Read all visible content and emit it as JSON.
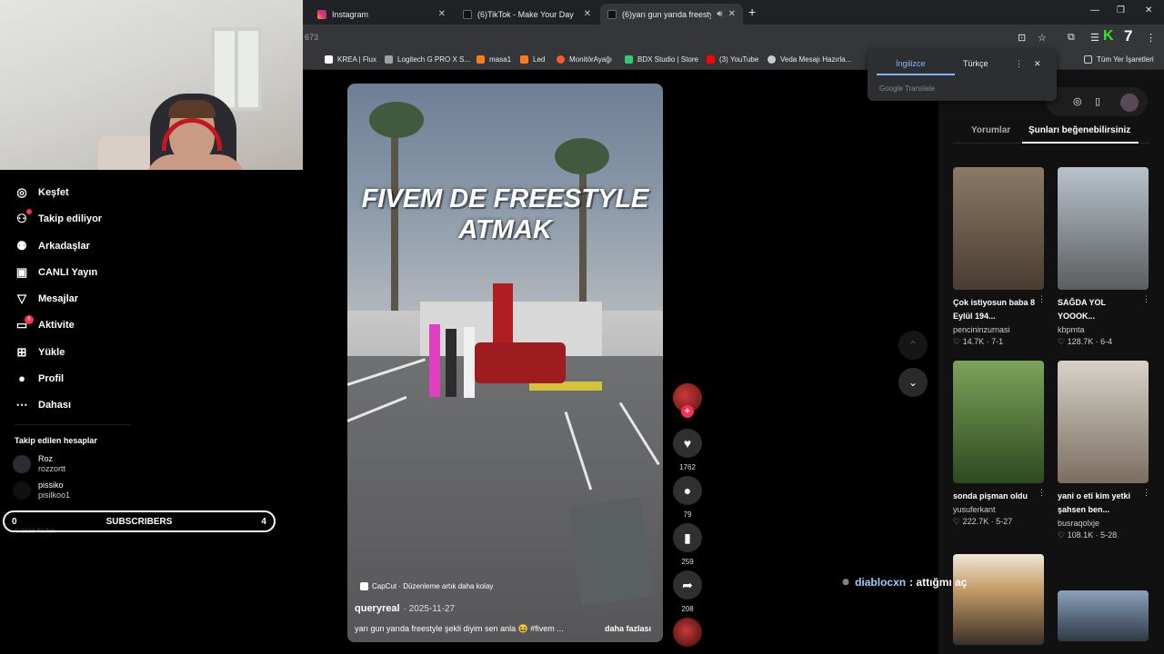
{
  "browser": {
    "tabs": [
      {
        "title": "Instagram",
        "color": "#e1306c"
      },
      {
        "title": "(6)TikTok - Make Your Day",
        "color": "#111111"
      },
      {
        "title": "(6)yarı gun yarıda freestyle",
        "color": "#111111"
      }
    ],
    "url": "673",
    "extension_badge": "7",
    "bookmarks": [
      {
        "label": "KREA | Flux",
        "color": "#ffffff"
      },
      {
        "label": "Logitech G PRO X S...",
        "color": "#9aa0a6"
      },
      {
        "label": "masa1",
        "color": "#ff7b1a"
      },
      {
        "label": "Led",
        "color": "#ff7b1a"
      },
      {
        "label": "MonitörAyağı",
        "color": "#ff5a1f"
      },
      {
        "label": "BDX Studio | Store",
        "color": "#2ecc71"
      },
      {
        "label": "(3) YouTube",
        "color": "#ff0000"
      },
      {
        "label": "Veda Mesajı Hazırla...",
        "color": "#cccccc"
      }
    ],
    "all_bookmarks": "Tüm Yer İşaretleri"
  },
  "translate": {
    "lang_from": "İngilizce",
    "lang_to": "Türkçe",
    "footer": "Google Translate"
  },
  "sidebar": {
    "items": [
      {
        "label": "Keşfet",
        "icon": "compass-icon"
      },
      {
        "label": "Takip ediliyor",
        "icon": "user-follow-icon"
      },
      {
        "label": "Arkadaşlar",
        "icon": "friends-icon"
      },
      {
        "label": "CANLI Yayın",
        "icon": "live-icon"
      },
      {
        "label": "Mesajlar",
        "icon": "message-icon"
      },
      {
        "label": "Aktivite",
        "icon": "activity-icon"
      },
      {
        "label": "Yükle",
        "icon": "upload-icon"
      },
      {
        "label": "Profil",
        "icon": "profile-icon"
      },
      {
        "label": "Dahası",
        "icon": "more-icon"
      }
    ],
    "activity_badge": "6",
    "followed_title": "Takip edilen hesaplar",
    "followed": [
      {
        "name": "Roz",
        "handle": "rozzortt"
      },
      {
        "name": "pissiko",
        "handle": "pisilkoo1"
      }
    ],
    "copyright": "© 2026 TikTok"
  },
  "subscribers_bar": {
    "left": "0",
    "label": "SUBSCRIBERS",
    "right": "4"
  },
  "video": {
    "title_line1": "FIVEM DE FREESTYLE",
    "title_line2": "ATMAK",
    "capcut": "CapCut · Düzenleme artık daha kolay",
    "author": "queryreal",
    "date": "· 2025-11-27",
    "description": "yarı gun yarıda freestyle şekli diyim sen anla 😆 #fivem ...",
    "more": "daha fazlası"
  },
  "actions": {
    "likes": "1762",
    "comments": "79",
    "saves": "259",
    "shares": "208"
  },
  "right_panel": {
    "tab_comments": "Yorumlar",
    "tab_suggested": "Şunları beğenebilirsiniz",
    "cards": [
      {
        "title": "Çok istiyosun baba 8 Eylül 194...",
        "user": "pencininzurnasi",
        "stats": "♡ 14.7K · 7-1",
        "color1": "#6b5a4a",
        "color2": "#3e342c"
      },
      {
        "title": "SAĞDA YOL YOOOK...",
        "user": "kbpmta",
        "stats": "♡ 128.7K · 6-4",
        "color1": "#9aa6b0",
        "color2": "#5b5d5e"
      },
      {
        "title": "sonda pişman oldu",
        "user": "yusuferkant",
        "stats": "♡ 222.7K · 5-27",
        "color1": "#4e7a34",
        "color2": "#263e1c"
      },
      {
        "title": "yani o eti kim yetki şahsen ben...",
        "user": "busraqolxje",
        "stats": "♡ 108.1K · 5-28",
        "color1": "#b9b3a8",
        "color2": "#6d6458"
      },
      {
        "title": "",
        "user": "",
        "stats": "",
        "color1": "#c8bca6",
        "color2": "#3a3028"
      },
      {
        "title": "",
        "user": "",
        "stats": "",
        "color1": "#6d8098",
        "color2": "#2e3a46"
      }
    ]
  },
  "chat": {
    "user": "diablocxn",
    "message": ": attığmı aç"
  }
}
